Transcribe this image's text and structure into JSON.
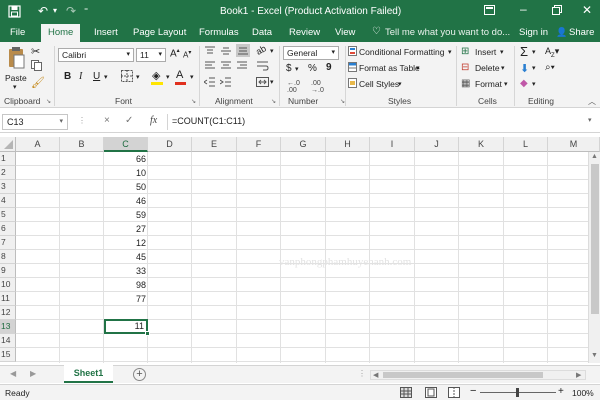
{
  "window": {
    "title": "Book1 - Excel (Product Activation Failed)",
    "tell_me": "Tell me what you want to do...",
    "sign_in": "Sign in",
    "share": "Share"
  },
  "tabs": [
    "File",
    "Home",
    "Insert",
    "Page Layout",
    "Formulas",
    "Data",
    "Review",
    "View"
  ],
  "ribbon": {
    "clipboard": {
      "label": "Clipboard",
      "paste": "Paste"
    },
    "font": {
      "label": "Font",
      "name": "Calibri",
      "size": "11",
      "bold": "B",
      "italic": "I",
      "underline": "U"
    },
    "alignment": {
      "label": "Alignment"
    },
    "number": {
      "label": "Number",
      "format": "General",
      "currency": "$",
      "percent": "%",
      "comma": "9"
    },
    "styles": {
      "label": "Styles",
      "conditional": "Conditional Formatting",
      "format_table": "Format as Table",
      "cell_styles": "Cell Styles"
    },
    "cells": {
      "label": "Cells",
      "insert": "Insert",
      "delete": "Delete",
      "format": "Format"
    },
    "editing": {
      "label": "Editing"
    }
  },
  "formula_bar": {
    "name_box": "C13",
    "cancel": "×",
    "enter": "✓",
    "fx": "fx",
    "formula": "=COUNT(C1:C11)"
  },
  "grid": {
    "columns": [
      "A",
      "B",
      "C",
      "D",
      "E",
      "F",
      "G",
      "H",
      "I",
      "J",
      "K",
      "L",
      "M"
    ],
    "rows": [
      "1",
      "2",
      "3",
      "4",
      "5",
      "6",
      "7",
      "8",
      "9",
      "10",
      "11",
      "12",
      "13",
      "14",
      "15"
    ],
    "column_c_values": [
      "66",
      "10",
      "50",
      "46",
      "59",
      "27",
      "12",
      "45",
      "33",
      "98",
      "77",
      "",
      "11",
      "",
      ""
    ],
    "selected_cell": "C13"
  },
  "watermark": "vanphongphamhuyenanh.com",
  "sheets": {
    "tabs": [
      "Sheet1"
    ],
    "add": "+"
  },
  "status": {
    "ready": "Ready",
    "zoom": "100%",
    "zoom_minus": "−",
    "zoom_plus": "+"
  }
}
